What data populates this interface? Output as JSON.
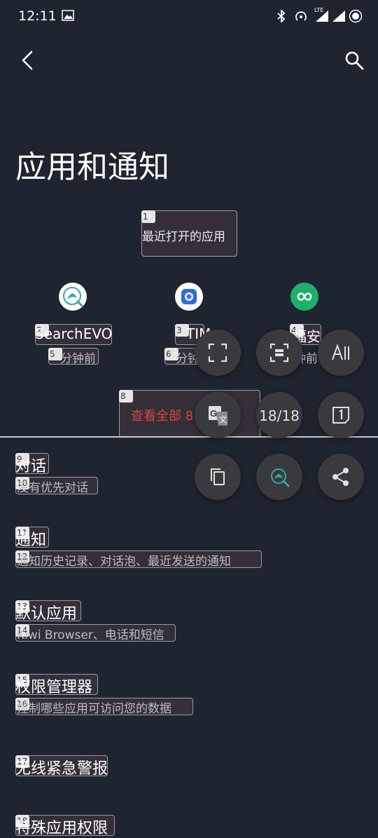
{
  "status_bar": {
    "time": "12:11",
    "network_label": "LTE"
  },
  "app_bar": {
    "back_icon": "back-arrow-icon",
    "search_icon": "search-icon"
  },
  "page": {
    "title": "应用和通知"
  },
  "recent": {
    "header": "最近打开的应用",
    "apps": [
      {
        "name": "SearchEVO",
        "time": "分钟前",
        "icon": "search-evo-icon",
        "color": "#ffffff"
      },
      {
        "name": "TIM",
        "time": "分钟",
        "icon": "tim-icon",
        "color": "#ffffff"
      },
      {
        "name": "福安",
        "time": "钟前",
        "icon": "infinity-icon",
        "color": "#1db06a"
      }
    ],
    "view_all": "查看全部 8 个应用"
  },
  "settings": [
    {
      "title": "对话",
      "subtitle": "没有优先对话"
    },
    {
      "title": "通知",
      "subtitle": "通知历史记录、对话泡、最近发送的通知"
    },
    {
      "title": "默认应用",
      "subtitle": "Kiwi Browser、电话和短信"
    },
    {
      "title": "权限管理器",
      "subtitle": "控制哪些应用可访问您的数据"
    },
    {
      "title": "无线紧急警报"
    },
    {
      "title": "特殊应用权限"
    }
  ],
  "overlay": {
    "badges": [
      "1",
      "2",
      "3",
      "4",
      "5",
      "6",
      "8",
      "9",
      "10",
      "11",
      "12",
      "13",
      "14",
      "15",
      "16",
      "17",
      "18"
    ],
    "page_counter": "18/18",
    "buttons": [
      "fullscreen-icon",
      "scan-icon",
      "text-size-icon",
      "translate-icon",
      "counter",
      "first-page-icon",
      "copy-icon",
      "search-evo-icon",
      "share-icon"
    ]
  },
  "colors": {
    "background": "#1f2530",
    "accent_red": "#d8453a",
    "fab": "#3a3a3e"
  }
}
